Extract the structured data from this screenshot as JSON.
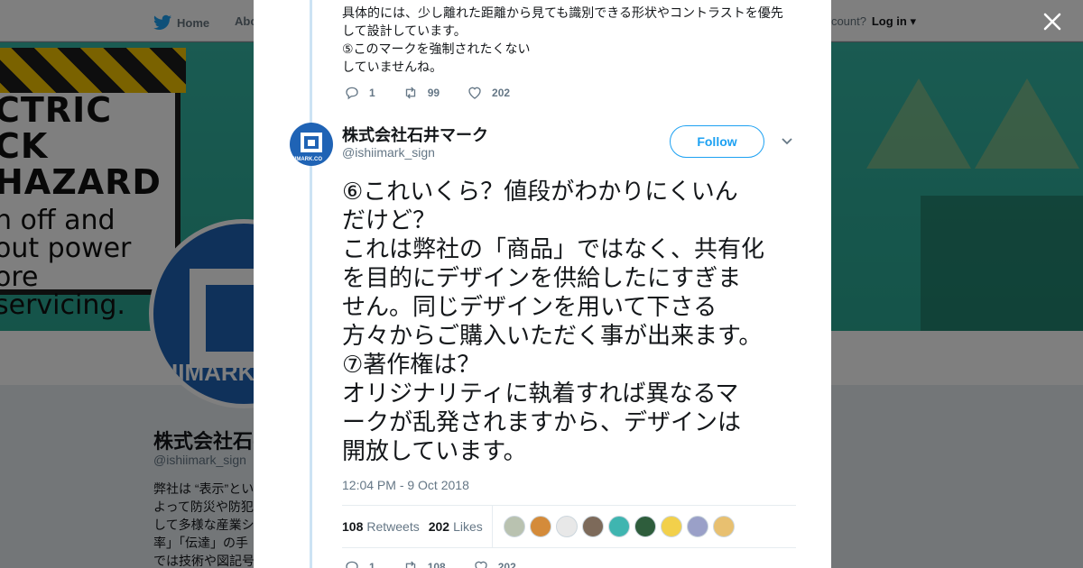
{
  "background": {
    "nav": {
      "home_label": "Home",
      "about_label": "Abo",
      "account_text": "ccount?",
      "login_label": "Log in"
    },
    "sign_lines": [
      "CTRIC",
      "CK HAZARD",
      "n off and",
      "out power",
      "ore servicing."
    ],
    "avatar_label": "IIMARK",
    "profile_name": "株式会社石井",
    "profile_handle": "@ishiimark_sign",
    "bio_lines": [
      "弊社は “表示”とい",
      "よって防災や防犯",
      "して多様な産業シ",
      "率」「伝達」の手",
      "では技術や図記号"
    ]
  },
  "previous_tweet": {
    "lines": [
      "具体的には、少し離れた距離から見ても識別できる形状やコントラストを優先",
      "して設計しています。",
      "⑤このマークを強制されたくない",
      "していませんね。"
    ],
    "replies": "1",
    "retweets": "99",
    "likes": "202"
  },
  "tweet": {
    "author_name": "株式会社石井マーク",
    "author_handle": "@ishiimark_sign",
    "avatar_label": "IIMARK.CO",
    "follow_label": "Follow",
    "text_lines": [
      "⑥これいくら？値段がわかりにくいん",
      "だけど？",
      "これは弊社の「商品」ではなく、共有化",
      "を目的にデザインを供給したにすぎま",
      "せん。同じデザインを用いて下さる",
      "方々からご購入いただく事が出来ます。",
      "⑦著作権は？",
      "オリジナリティに執着すれば異なるマ",
      "ークが乱発されますから、デザインは",
      "開放しています。"
    ],
    "timestamp": "12:04 PM - 9 Oct 2018",
    "retweet_count": "108",
    "retweets_label": "Retweets",
    "like_count": "202",
    "likes_label": "Likes",
    "replies": "1",
    "retweets": "108",
    "likes": "202",
    "liker_colors": [
      "#b9c2b0",
      "#d48b3a",
      "#e8e8e8",
      "#7d6a5a",
      "#3fb5b0",
      "#2e5d3c",
      "#f2d04b",
      "#9aa0c8",
      "#e8c070"
    ]
  }
}
